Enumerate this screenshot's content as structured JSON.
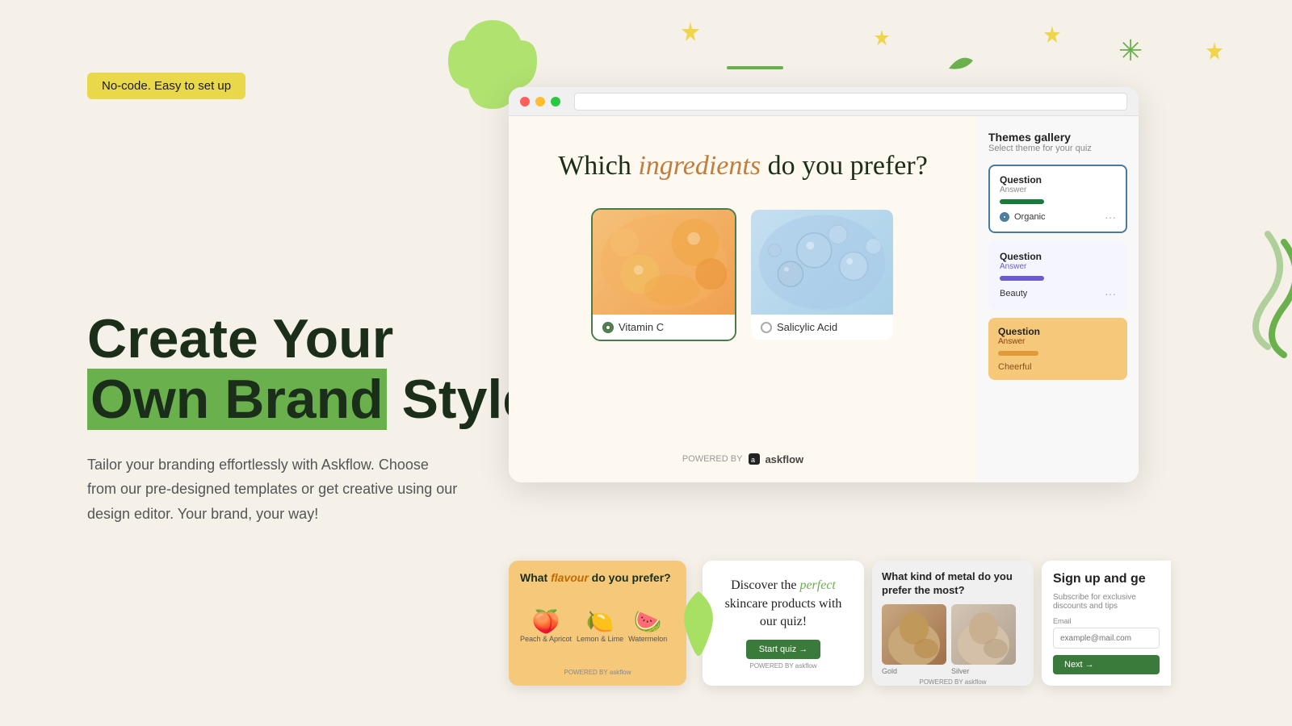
{
  "badge": {
    "text": "No-code. Easy to set up"
  },
  "headline": {
    "line1": "Create Your",
    "line2_highlight": "Own Brand",
    "line2_after": " Style"
  },
  "description": {
    "text": "Tailor your branding effortlessly with Askflow. Choose from our pre-designed templates or get creative using our design editor. Your brand, your way!"
  },
  "quiz": {
    "question_prefix": "Which ",
    "question_italic": "ingredients",
    "question_suffix": " do you prefer?",
    "option1_label": "Vitamin C",
    "option2_label": "Salicylic Acid",
    "powered_by": "POWERED BY",
    "brand": "askflow"
  },
  "themes": {
    "title": "Themes gallery",
    "subtitle": "Select theme for your quiz",
    "card1": {
      "title": "Question",
      "answer": "Answer",
      "label": "Organic"
    },
    "card2": {
      "title": "Question",
      "answer": "Answer",
      "label": "Beauty"
    },
    "card3": {
      "title": "Question",
      "answer": "Answer",
      "label": "Cheerful"
    }
  },
  "mini_cards": {
    "flavour": {
      "question_prefix": "What ",
      "question_italic": "flavour",
      "question_suffix": " do you prefer?",
      "fruit1": "Peach & Apricot",
      "fruit2": "Lemon & Lime",
      "fruit3": "Watermelon"
    },
    "skincare": {
      "text_prefix": "Discover the ",
      "text_italic": "perfect",
      "text_suffix": " skincare products with our quiz!",
      "button": "Start quiz →"
    },
    "metal": {
      "question": "What kind of metal do you prefer the most?",
      "option1": "Gold",
      "option2": "Silver"
    },
    "signup": {
      "title": "Sign up and ge",
      "subtitle": "Subscribe for exclusive discounts and tips",
      "email_placeholder": "example@mail.com",
      "button": "Next →"
    }
  }
}
